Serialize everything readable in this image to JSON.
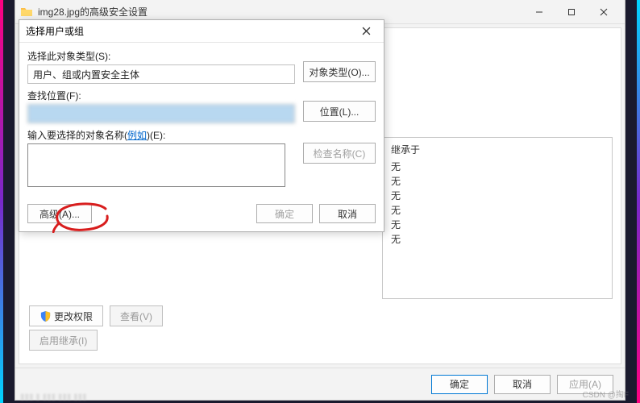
{
  "outer_window": {
    "title": "img28.jpg的高级安全设置",
    "controls": {
      "minimize": "—",
      "maximize": "□",
      "close": "✕"
    }
  },
  "inherit_panel": {
    "header": "继承于",
    "items": [
      "无",
      "无",
      "无",
      "无",
      "无",
      "无"
    ]
  },
  "actions": {
    "change_permissions": "更改权限",
    "view": "查看(V)",
    "enable_inherit": "启用继承(I)"
  },
  "outer_buttons": {
    "ok": "确定",
    "cancel": "取消",
    "apply": "应用(A)"
  },
  "inner_dialog": {
    "title": "选择用户或组",
    "close": "✕",
    "object_type_label": "选择此对象类型(S):",
    "object_type_value": "用户、组或内置安全主体",
    "object_type_button": "对象类型(O)...",
    "location_label": "查找位置(F):",
    "location_value": "                    ",
    "location_button": "位置(L)...",
    "names_label_pre": "输入要选择的对象名称(",
    "names_label_link": "例如",
    "names_label_post": ")(E):",
    "check_names": "检查名称(C)",
    "advanced": "高级(A)...",
    "ok": "确定",
    "cancel": "取消"
  },
  "watermark": "CSDN @掏F"
}
